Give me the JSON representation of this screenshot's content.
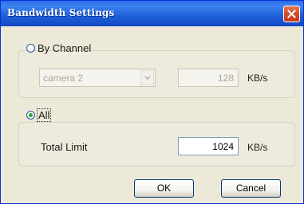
{
  "window": {
    "title": "Bandwidth Settings"
  },
  "by_channel": {
    "label": "By Channel",
    "selected": false,
    "camera_select": {
      "value": "camera 2"
    },
    "bandwidth_value": "128",
    "unit": "KB/s"
  },
  "all": {
    "label": "All",
    "selected": true,
    "total_limit_label": "Total Limit",
    "total_limit_value": "1024",
    "unit": "KB/s"
  },
  "buttons": {
    "ok": "OK",
    "cancel": "Cancel"
  },
  "colors": {
    "titlebar": "#1d5fd8",
    "window_bg": "#ece9d8",
    "close_button": "#d2482a",
    "radio_check": "#2fa43a"
  },
  "icons": {
    "close": "close-x-icon",
    "dropdown": "chevron-down-icon"
  }
}
